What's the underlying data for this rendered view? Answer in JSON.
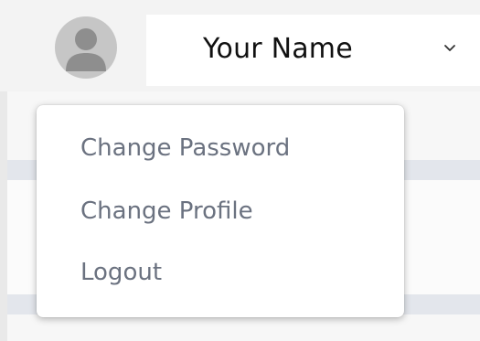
{
  "header": {
    "user_name": "Your Name"
  },
  "icons": {
    "avatar": "user-avatar-icon",
    "toggle": "chevron-down-icon"
  },
  "colors": {
    "avatar_bg": "#c6c6c6",
    "avatar_fg": "#8e8e8e",
    "menu_text": "#6b7280",
    "name_text": "#111111"
  },
  "menu": {
    "items": [
      {
        "label": "Change Password"
      },
      {
        "label": "Change Profile"
      },
      {
        "label": "Logout"
      }
    ]
  }
}
